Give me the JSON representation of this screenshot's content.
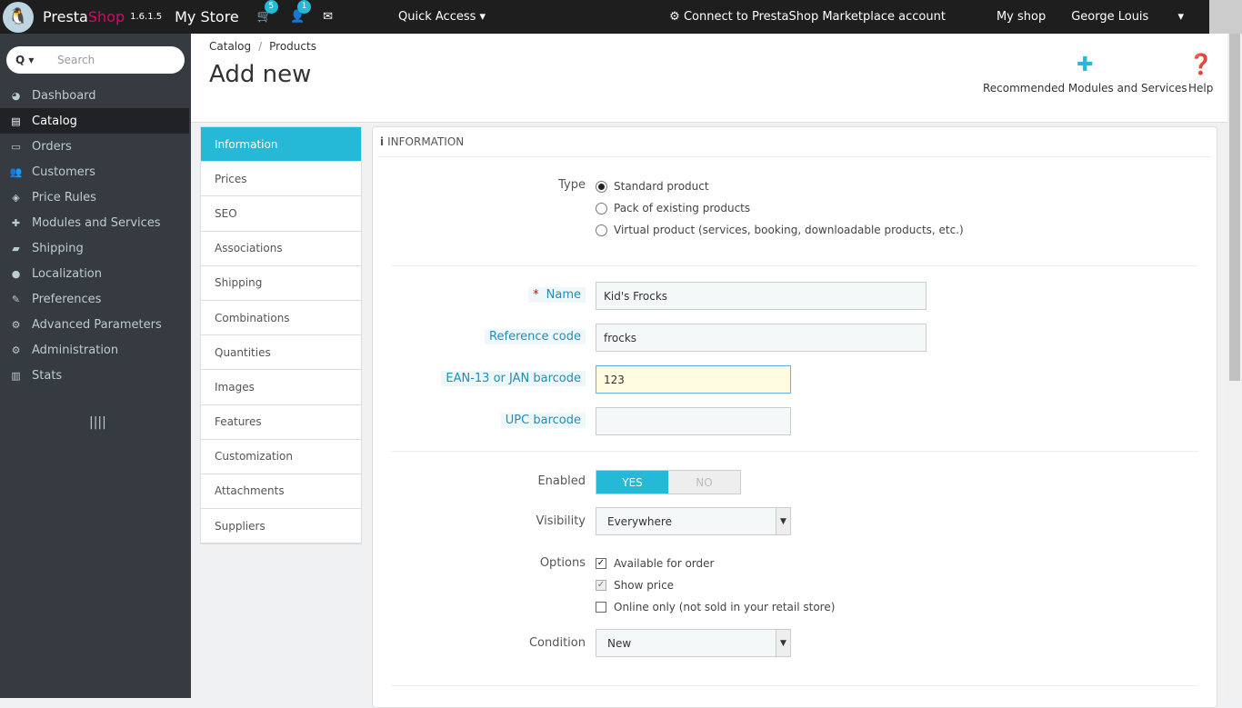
{
  "topbar": {
    "brand_a": "Presta",
    "brand_b": "Shop",
    "version": "1.6.1.5",
    "store": "My Store",
    "cart_count": "5",
    "customers_count": "1",
    "quick_access": "Quick Access",
    "marketplace": "Connect to PrestaShop Marketplace account",
    "my_shop": "My shop",
    "user": "George Louis"
  },
  "sidebar": {
    "search_placeholder": "Search",
    "items": [
      {
        "label": "Dashboard",
        "icon": "◕"
      },
      {
        "label": "Catalog",
        "icon": "▤"
      },
      {
        "label": "Orders",
        "icon": "▭"
      },
      {
        "label": "Customers",
        "icon": "👥"
      },
      {
        "label": "Price Rules",
        "icon": "◈"
      },
      {
        "label": "Modules and Services",
        "icon": "✚"
      },
      {
        "label": "Shipping",
        "icon": "▰"
      },
      {
        "label": "Localization",
        "icon": "●"
      },
      {
        "label": "Preferences",
        "icon": "✎"
      },
      {
        "label": "Advanced Parameters",
        "icon": "⚙"
      },
      {
        "label": "Administration",
        "icon": "⚙"
      },
      {
        "label": "Stats",
        "icon": "▥"
      }
    ]
  },
  "header": {
    "breadcrumb": [
      "Catalog",
      "Products"
    ],
    "title": "Add new",
    "recommended": "Recommended Modules and Services",
    "help": "Help"
  },
  "tabs": [
    "Information",
    "Prices",
    "SEO",
    "Associations",
    "Shipping",
    "Combinations",
    "Quantities",
    "Images",
    "Features",
    "Customization",
    "Attachments",
    "Suppliers"
  ],
  "panel": {
    "title": "INFORMATION",
    "type_label": "Type",
    "types": [
      "Standard product",
      "Pack of existing products",
      "Virtual product (services, booking, downloadable products, etc.)"
    ],
    "name_label": "Name",
    "name_value": "Kid's Frocks",
    "ref_label": "Reference code",
    "ref_value": "frocks",
    "ean_label": "EAN-13 or JAN barcode",
    "ean_value": "123",
    "upc_label": "UPC barcode",
    "upc_value": "",
    "enabled_label": "Enabled",
    "yes": "YES",
    "no": "NO",
    "visibility_label": "Visibility",
    "visibility_value": "Everywhere",
    "options_label": "Options",
    "options": [
      "Available for order",
      "Show price",
      "Online only (not sold in your retail store)"
    ],
    "condition_label": "Condition",
    "condition_value": "New"
  }
}
